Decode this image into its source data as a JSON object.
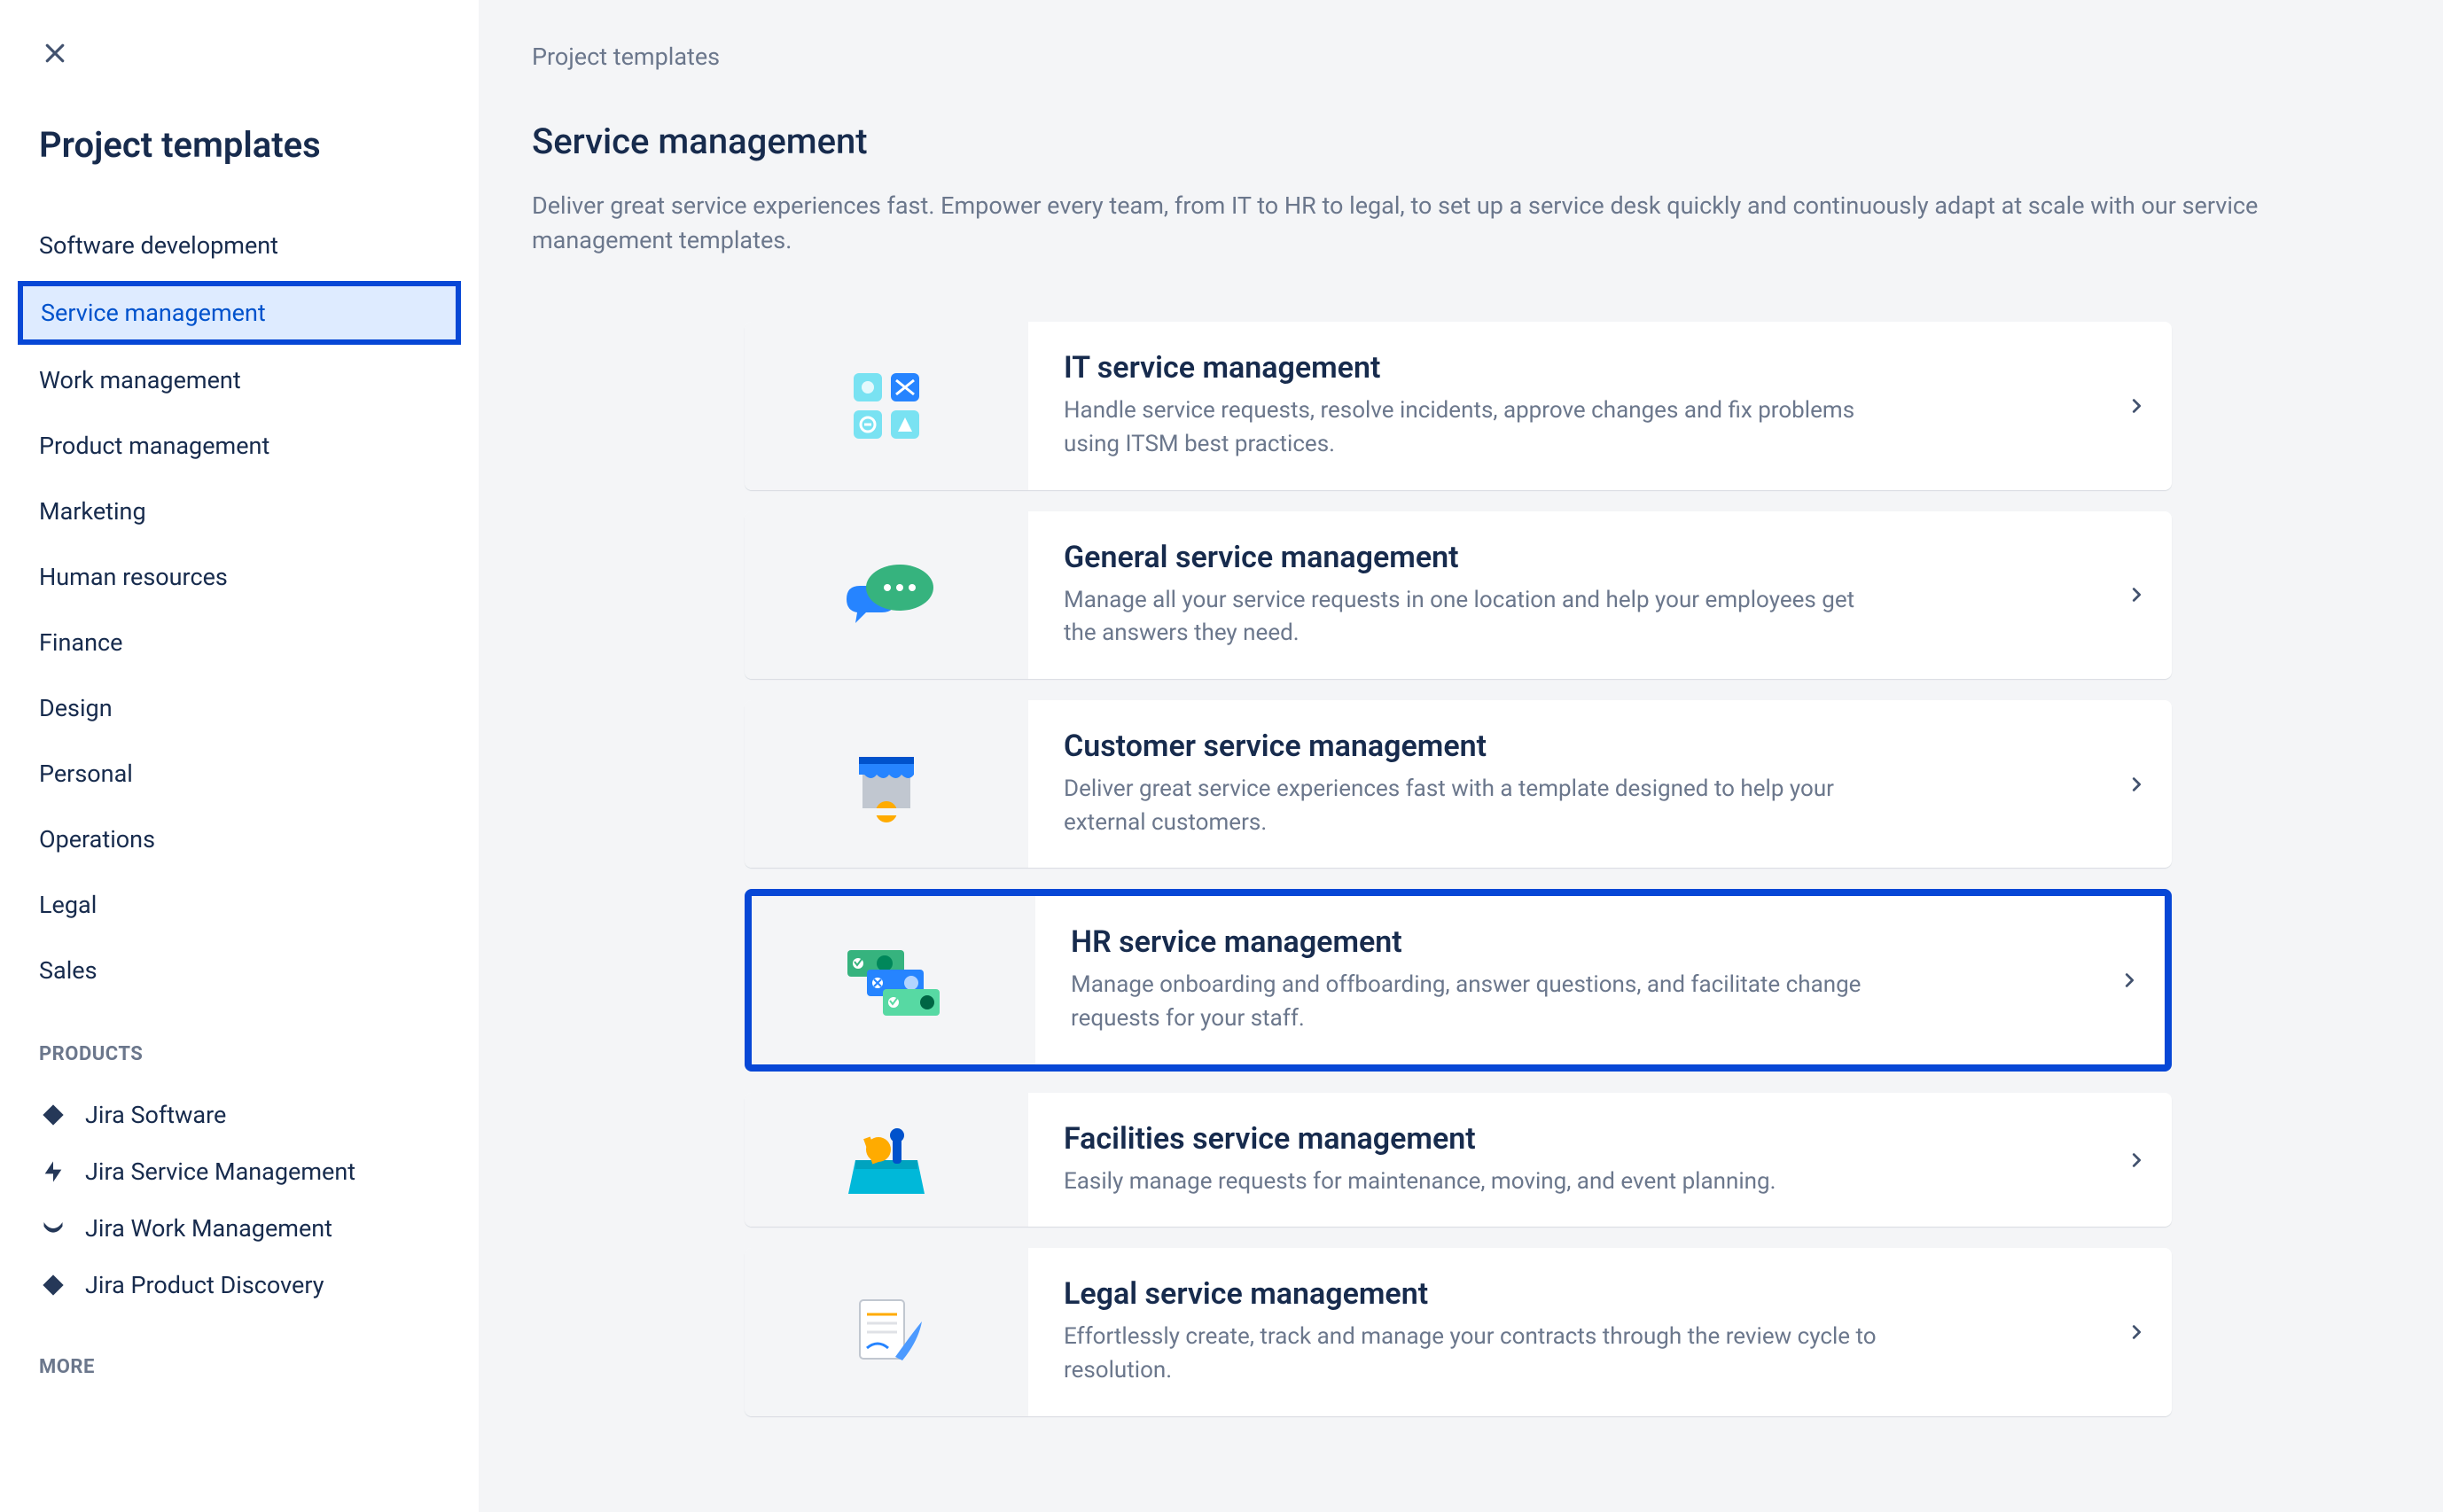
{
  "sidebar": {
    "title": "Project templates",
    "categories": [
      {
        "label": "Software development",
        "selected": false
      },
      {
        "label": "Service management",
        "selected": true
      },
      {
        "label": "Work management",
        "selected": false
      },
      {
        "label": "Product management",
        "selected": false
      },
      {
        "label": "Marketing",
        "selected": false
      },
      {
        "label": "Human resources",
        "selected": false
      },
      {
        "label": "Finance",
        "selected": false
      },
      {
        "label": "Design",
        "selected": false
      },
      {
        "label": "Personal",
        "selected": false
      },
      {
        "label": "Operations",
        "selected": false
      },
      {
        "label": "Legal",
        "selected": false
      },
      {
        "label": "Sales",
        "selected": false
      }
    ],
    "products_label": "PRODUCTS",
    "products": [
      {
        "label": "Jira Software",
        "icon": "jira-software"
      },
      {
        "label": "Jira Service Management",
        "icon": "jira-service-management"
      },
      {
        "label": "Jira Work Management",
        "icon": "jira-work-management"
      },
      {
        "label": "Jira Product Discovery",
        "icon": "jira-product-discovery"
      }
    ],
    "more_label": "MORE"
  },
  "main": {
    "breadcrumb": "Project templates",
    "title": "Service management",
    "description": "Deliver great service experiences fast. Empower every team, from IT to HR to legal, to set up a service desk quickly and continuously adapt at scale with our service management templates.",
    "templates": [
      {
        "title": "IT service management",
        "desc": "Handle service requests, resolve incidents, approve changes and fix problems using ITSM best practices.",
        "highlighted": false,
        "thumb": "itsm"
      },
      {
        "title": "General service management",
        "desc": "Manage all your service requests in one location and help your employees get the answers they need.",
        "highlighted": false,
        "thumb": "general"
      },
      {
        "title": "Customer service management",
        "desc": "Deliver great service experiences fast with a template designed to help your external customers.",
        "highlighted": false,
        "thumb": "customer"
      },
      {
        "title": "HR service management",
        "desc": "Manage onboarding and offboarding, answer questions, and facilitate change requests for your staff.",
        "highlighted": true,
        "thumb": "hr"
      },
      {
        "title": "Facilities service management",
        "desc": "Easily manage requests for maintenance, moving, and event planning.",
        "highlighted": false,
        "thumb": "facilities"
      },
      {
        "title": "Legal service management",
        "desc": "Effortlessly create, track and manage your contracts through the review cycle to resolution.",
        "highlighted": false,
        "thumb": "legal"
      }
    ]
  }
}
